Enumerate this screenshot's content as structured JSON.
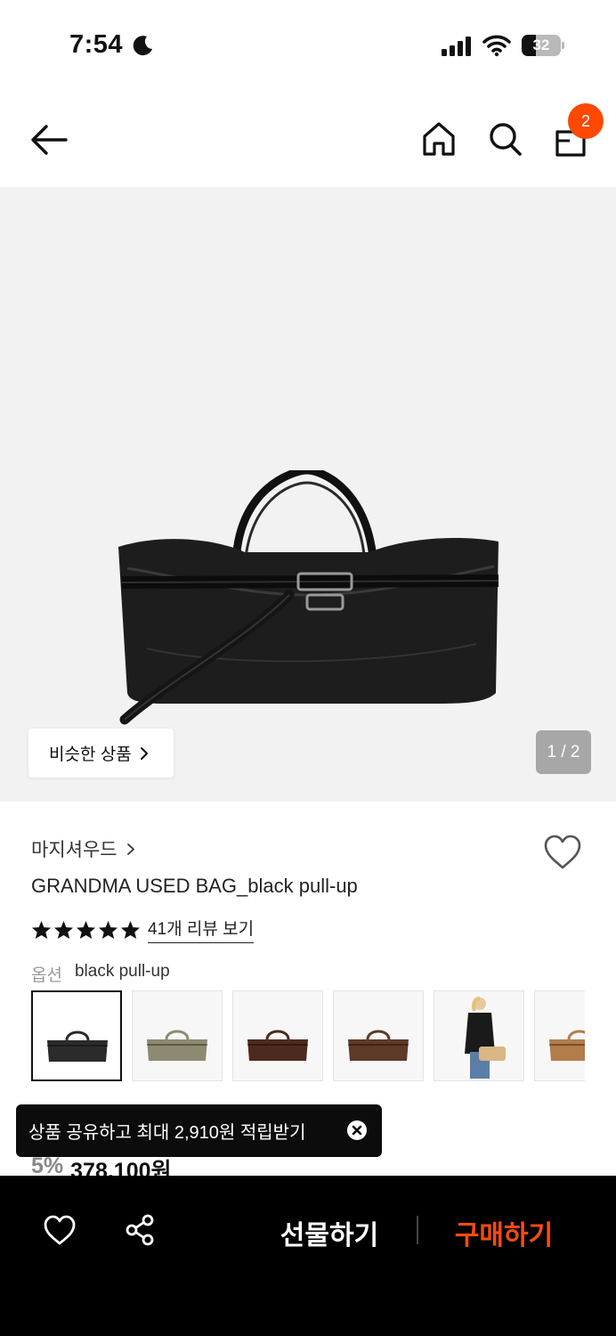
{
  "status_bar": {
    "time": "7:54",
    "battery": "32"
  },
  "header": {
    "cart_count": "2"
  },
  "gallery": {
    "similar_label": "비슷한 상품",
    "page_indicator": "1 / 2"
  },
  "product": {
    "brand": "마지셔우드",
    "name": "GRANDMA USED BAG_black pull-up",
    "rating_stars": 5,
    "review_link": "41개 리뷰 보기",
    "option_label": "옵션",
    "option_value": "black pull-up",
    "discount": "5%",
    "price": "378,100원"
  },
  "thumbnails": [
    {
      "name": "black",
      "color": "#2b2b2b"
    },
    {
      "name": "khaki",
      "color": "#8d8a72"
    },
    {
      "name": "dark-brown",
      "color": "#4c2a1f"
    },
    {
      "name": "brown",
      "color": "#5e3a28"
    },
    {
      "name": "model-photo",
      "color": "#d9b684"
    },
    {
      "name": "tan",
      "color": "#b37c4b"
    }
  ],
  "toast": {
    "message": "상품 공유하고 최대 2,910원 적립받기"
  },
  "bottom_bar": {
    "gift_label": "선물하기",
    "buy_label": "구매하기"
  },
  "colors": {
    "accent": "#ff4b10",
    "badge": "#ff4800"
  }
}
